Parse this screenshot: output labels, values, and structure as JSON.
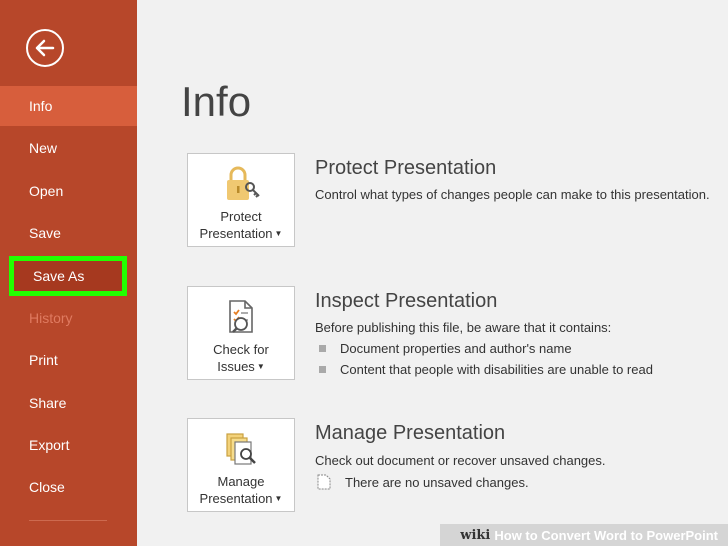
{
  "sidebar": {
    "back_icon": "back-arrow-icon",
    "items": [
      {
        "label": "Info"
      },
      {
        "label": "New"
      },
      {
        "label": "Open"
      },
      {
        "label": "Save"
      },
      {
        "label": "Save As"
      },
      {
        "label": "History"
      },
      {
        "label": "Print"
      },
      {
        "label": "Share"
      },
      {
        "label": "Export"
      },
      {
        "label": "Close"
      }
    ]
  },
  "main": {
    "title": "Info",
    "sections": [
      {
        "tile_line1": "Protect",
        "tile_line2": "Presentation",
        "title": "Protect Presentation",
        "desc": "Control what types of changes people can make to this presentation."
      },
      {
        "tile_line1": "Check for",
        "tile_line2": "Issues",
        "title": "Inspect Presentation",
        "desc": "Before publishing this file, be aware that it contains:",
        "bullets": [
          "Document properties and author's name",
          "Content that people with disabilities are unable to read"
        ]
      },
      {
        "tile_line1": "Manage",
        "tile_line2": "Presentation",
        "title": "Manage Presentation",
        "desc": "Check out document or recover unsaved changes.",
        "note": "There are no unsaved changes."
      }
    ]
  },
  "watermark": {
    "wiki": "wiki",
    "text": "How to Convert Word to PowerPoint"
  },
  "colors": {
    "sidebar": "#b7472a",
    "active": "#d75e3c",
    "highlight_border": "#22ff00"
  }
}
